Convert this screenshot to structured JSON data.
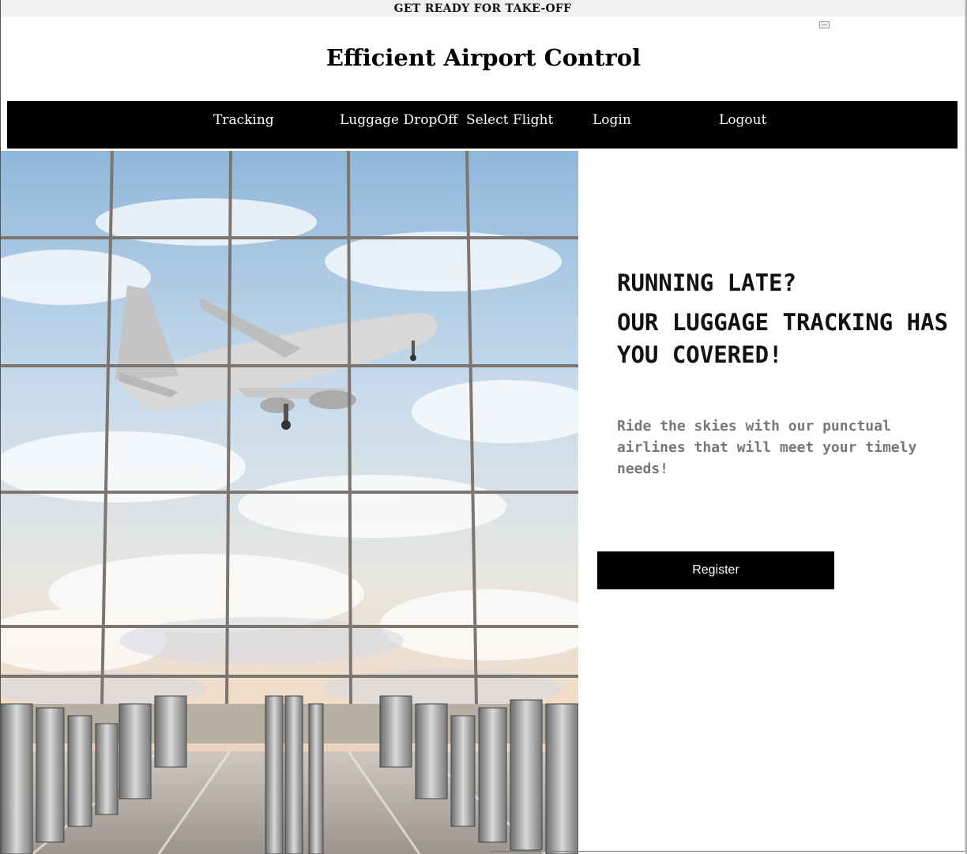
{
  "banner": {
    "text": "GET READY FOR TAKE-OFF"
  },
  "header": {
    "title": "Efficient Airport Control"
  },
  "nav": {
    "items": [
      {
        "label": "Tracking"
      },
      {
        "label": "Luggage DropOff"
      },
      {
        "label": "Select Flight"
      },
      {
        "label": "Login"
      },
      {
        "label": "Logout"
      }
    ]
  },
  "hero": {
    "image_subject": "airplane-through-terminal-window",
    "headline_line1": "RUNNING LATE?",
    "headline_line2": "OUR LUGGAGE TRACKING HAS YOU COVERED!",
    "subtitle": "Ride the skies with our punctual airlines that will meet your timely needs!",
    "register_label": "Register"
  },
  "colors": {
    "navbar_bg": "#000000",
    "nav_text": "#ffffff",
    "button_bg": "#000000",
    "subtitle_text": "#777777",
    "banner_bg": "#f1f1f1"
  }
}
